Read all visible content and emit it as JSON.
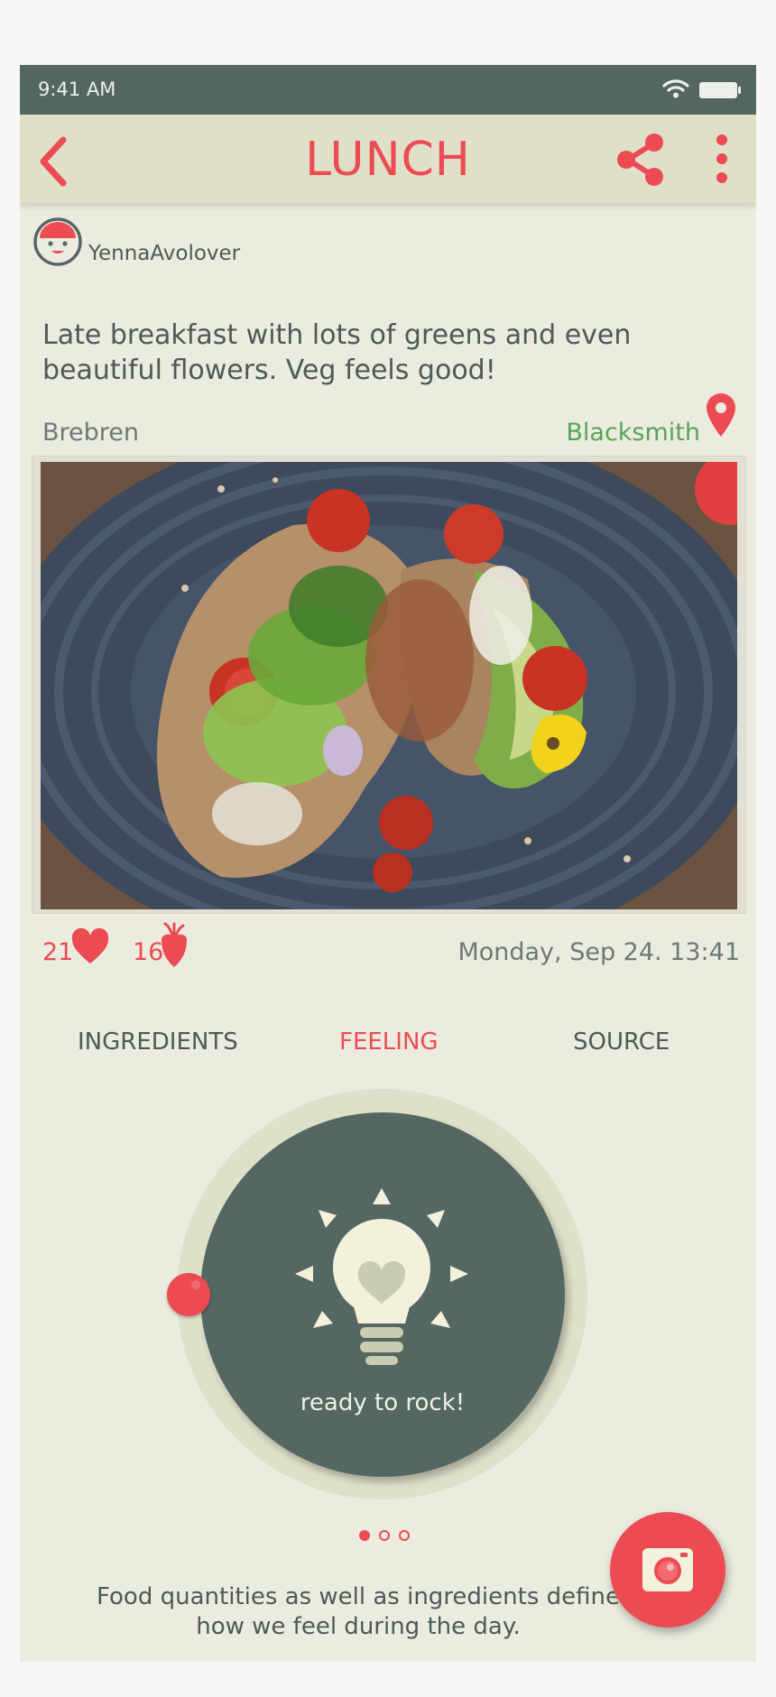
{
  "status_bar": {
    "time": "9:41 AM",
    "wifi_icon": "wifi-icon",
    "battery_icon": "battery-icon"
  },
  "app_bar": {
    "title": "LUNCH",
    "back_icon": "chevron-left-icon",
    "share_icon": "share-icon",
    "more_icon": "more-vertical-icon"
  },
  "post": {
    "username": "YennaAvolover",
    "text": "Late breakfast with lots of greens and even beautiful flowers. Veg feels good!",
    "author": "Brebren",
    "place": "Blacksmith",
    "likes": "21",
    "veg_count": "16",
    "date": "Monday, Sep 24. 13:41"
  },
  "tabs": [
    {
      "label": "INGREDIENTS",
      "active": false
    },
    {
      "label": "FEELING",
      "active": true
    },
    {
      "label": "SOURCE",
      "active": false
    }
  ],
  "feeling": {
    "label": "ready to rock!",
    "icon": "lightbulb-heart-icon"
  },
  "pager": {
    "count": 3,
    "active_index": 0
  },
  "footer": {
    "text": "Food quantities as well as ingredients define how we feel during the day."
  },
  "colors": {
    "accent": "#ec4b53",
    "dark_slate": "#546762",
    "background": "#ecebdf",
    "app_bar": "#e0e0c8",
    "place_green": "#57a556"
  }
}
